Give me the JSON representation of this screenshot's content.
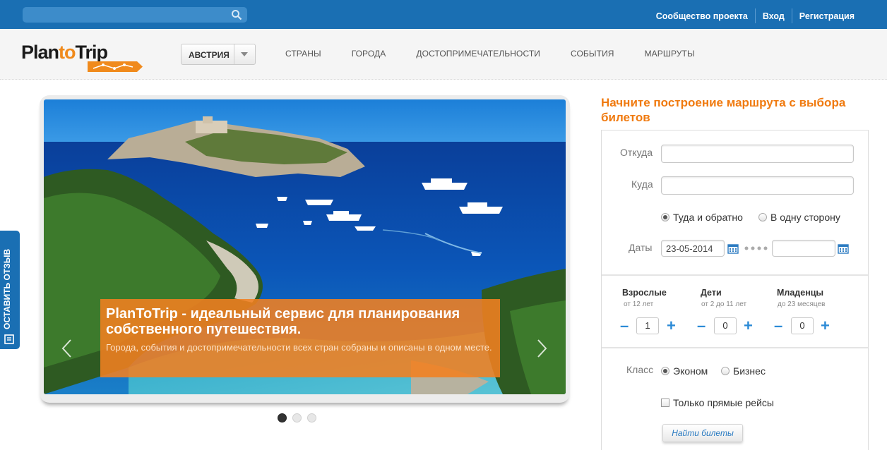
{
  "topbar": {
    "search_placeholder": "",
    "links": [
      "Сообщество проекта",
      "Вход",
      "Регистрация"
    ]
  },
  "header": {
    "logo": {
      "part1": "Plan",
      "part2": "to",
      "part3": "Trip"
    },
    "country": "АВСТРИЯ",
    "nav": [
      "СТРАНЫ",
      "ГОРОДА",
      "ДОСТОПРИМЕЧАТЕЛЬНОСТИ",
      "СОБЫТИЯ",
      "МАРШРУТЫ"
    ]
  },
  "slider": {
    "caption_title": "PlanToTrip - идеальный сервис для планирования собственного путешествия.",
    "caption_text": "Города, события и достопримечательности всех стран собраны и описаны в одном месте.",
    "active_slide": 1,
    "slide_count": 3
  },
  "feedback": {
    "label": "ОСТАВИТЬ ОТЗЫВ"
  },
  "booking": {
    "title": "Начните построение маршрута с выбора билетов",
    "from_label": "Откуда",
    "from_value": "",
    "to_label": "Куда",
    "to_value": "",
    "trip_roundtrip": "Туда и обратно",
    "trip_oneway": "В одну сторону",
    "trip_selected": "roundtrip",
    "dates_label": "Даты",
    "date_from": "23-05-2014",
    "date_to": "",
    "adults": {
      "label": "Взрослые",
      "sub": "от 12 лет",
      "count": "1"
    },
    "children": {
      "label": "Дети",
      "sub": "от 2 до 11 лет",
      "count": "0"
    },
    "infants": {
      "label": "Младенцы",
      "sub": "до 23 месяцев",
      "count": "0"
    },
    "minus": "–",
    "plus": "+",
    "class_label": "Класс",
    "class_economy": "Эконом",
    "class_business": "Бизнес",
    "class_selected": "economy",
    "direct_only": "Только прямые рейсы",
    "direct_checked": false,
    "find_button": "Найти билеты"
  },
  "colors": {
    "topbar": "#1a6fb3",
    "accent": "#f07a0f",
    "link": "#2b8ad6"
  }
}
